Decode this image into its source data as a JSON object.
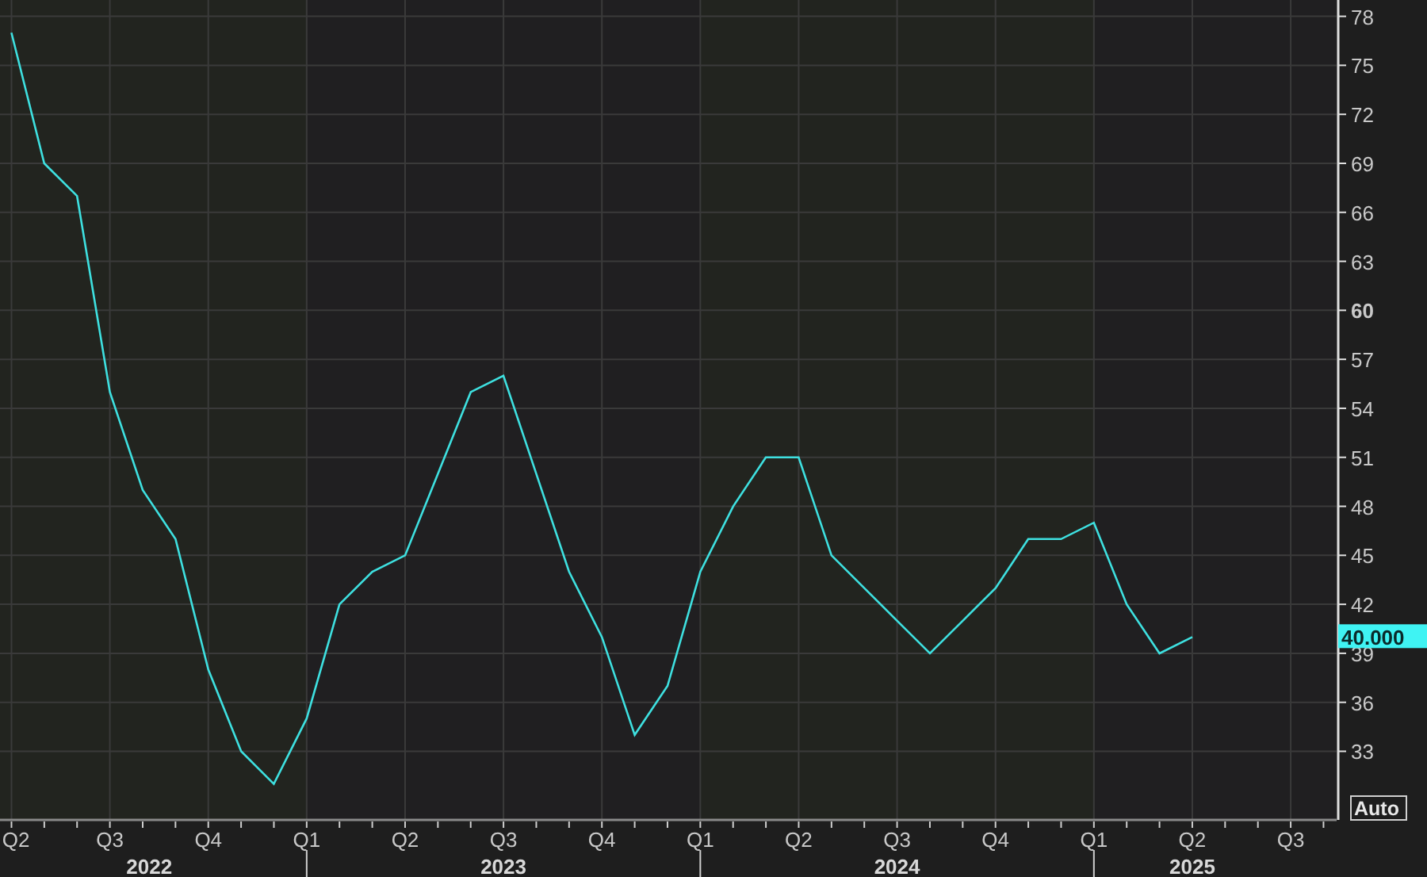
{
  "chart_data": {
    "type": "line",
    "categories": [
      "Q2",
      null,
      null,
      "Q3",
      null,
      null,
      "Q4",
      null,
      null,
      "Q1",
      null,
      null,
      "Q2",
      null,
      null,
      "Q3",
      null,
      null,
      "Q4",
      null,
      null,
      "Q1",
      null,
      null,
      "Q2",
      null,
      null,
      "Q3",
      null,
      null,
      "Q4",
      null,
      null,
      "Q1",
      null,
      null,
      "Q2",
      null,
      null,
      "Q3",
      null
    ],
    "series": [
      {
        "color": "#3ee0e0",
        "values": [
          77,
          69,
          67,
          55,
          49,
          46,
          38,
          33,
          31,
          35,
          42,
          44,
          45,
          50,
          55,
          56,
          50,
          44,
          40,
          34,
          37,
          44,
          48,
          51,
          51,
          45,
          43,
          41,
          39,
          41,
          43,
          46,
          46,
          47,
          42,
          39,
          40,
          null,
          null,
          null,
          null
        ]
      }
    ],
    "ylim": [
      28.8,
      79
    ],
    "grid": true,
    "yticks": [
      33,
      36,
      39,
      42,
      45,
      48,
      51,
      54,
      57,
      60,
      63,
      66,
      69,
      72,
      75,
      78
    ]
  },
  "year_labels": [
    "2022",
    "2023",
    "2024",
    "2025"
  ],
  "last_value": "40.000",
  "scale_button": "Auto"
}
